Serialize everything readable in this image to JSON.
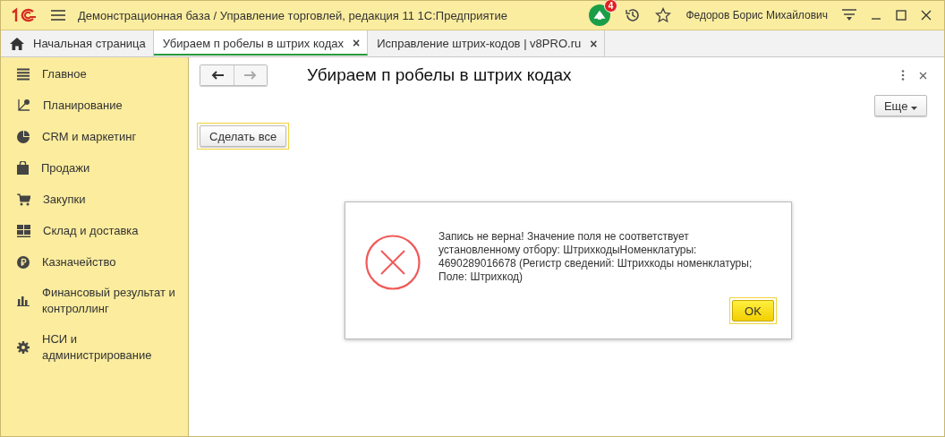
{
  "window": {
    "title": "Демонстрационная база / Управление торговлей, редакция 11 1С:Предприятие",
    "notifications": "4",
    "user": "Федоров Борис Михайлович"
  },
  "tabs": [
    {
      "label": "Начальная страница",
      "selected": false,
      "kind": "home"
    },
    {
      "label": "Убираем п робелы в штрих кодах",
      "selected": true,
      "kind": "doc",
      "close": "×"
    },
    {
      "label": "Исправление штрих-кодов | v8PRO.ru",
      "selected": false,
      "kind": "doc",
      "close": "×"
    }
  ],
  "sidebar": {
    "items": [
      {
        "label": "Главное"
      },
      {
        "label": "Планирование"
      },
      {
        "label": "CRM и маркетинг"
      },
      {
        "label": "Продажи"
      },
      {
        "label": "Закупки"
      },
      {
        "label": "Склад и доставка"
      },
      {
        "label": "Казначейство"
      },
      {
        "label": "Финансовый результат и контроллинг"
      },
      {
        "label": "НСИ и администрирование"
      }
    ]
  },
  "form": {
    "title": "Убираем п робелы в штрих кодах",
    "more_button": "Еще",
    "action_button": "Сделать все"
  },
  "dialog": {
    "message": "Запись не верна! Значение поля не соответствует\nустановленному отбору: ШтрихкодыНоменклатуры:\n4690289016678 (Регистр сведений: Штрихкоды номенклатуры;\nПоле: Штрихкод)",
    "ok_button": "OK"
  }
}
